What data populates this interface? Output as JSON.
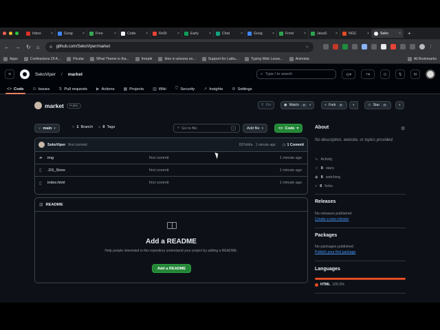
{
  "browser": {
    "tabs": [
      {
        "label": "Inbox",
        "color": "#d93025"
      },
      {
        "label": "Goog",
        "color": "#4285f4"
      },
      {
        "label": "Free",
        "color": "#34a853"
      },
      {
        "label": "Code",
        "color": "#f1f3f4"
      },
      {
        "label": "ReDi",
        "color": "#ea4335"
      },
      {
        "label": "Early",
        "color": "#0f9d58"
      },
      {
        "label": "Chat",
        "color": "#10a37f"
      },
      {
        "label": "Goog",
        "color": "#4285f4"
      },
      {
        "label": "Front",
        "color": "#2da44e"
      },
      {
        "label": "JavaS",
        "color": "#2da44e"
      },
      {
        "label": "NGC",
        "color": "#e34c26"
      },
      {
        "label": "Seko",
        "color": "#f0f6fc",
        "active": true
      }
    ],
    "url": "github.com/SekoViper/market",
    "bookmarks": [
      "Apps",
      "Confessions Of A...",
      "Picular",
      "What Theme is tha...",
      "freepik",
      "time in arizona no...",
      "Support for Latitu...",
      "Typing Web Lesso...",
      "Animista"
    ],
    "all_bookmarks": "All Bookmarks"
  },
  "header": {
    "owner": "SekoViper",
    "separator": "/",
    "repo": "market",
    "search_placeholder": "Type / to search",
    "search_key": "/"
  },
  "repo_nav": [
    {
      "icon": "<>",
      "label": "Code",
      "active": true
    },
    {
      "icon": "⊙",
      "label": "Issues"
    },
    {
      "icon": "⇅",
      "label": "Pull requests"
    },
    {
      "icon": "▶",
      "label": "Actions"
    },
    {
      "icon": "▦",
      "label": "Projects"
    },
    {
      "icon": "▥",
      "label": "Wiki"
    },
    {
      "icon": "⛉",
      "label": "Security"
    },
    {
      "icon": "↗",
      "label": "Insights"
    },
    {
      "icon": "⚙",
      "label": "Settings"
    }
  ],
  "repo": {
    "name": "market",
    "visibility": "Public",
    "pin": "Pin",
    "watch": "Watch",
    "watch_count": "0",
    "fork": "Fork",
    "fork_count": "0",
    "star": "Star",
    "star_count": "0"
  },
  "toolbar": {
    "branch": "main",
    "branch_count": "1",
    "branch_label": "Branch",
    "tag_count": "0",
    "tag_label": "Tags",
    "go_to_file": "Go to file",
    "go_to_file_key": "t",
    "add_file": "Add file",
    "code": "Code"
  },
  "latest_commit": {
    "user": "SekoViper",
    "message": "first commit",
    "hash_time": "837eb6a · 1 minute ago",
    "count_label": "1 Commit"
  },
  "files": [
    {
      "name": "img",
      "type": "folder",
      "message": "first commit",
      "time": "1 minute ago"
    },
    {
      "name": ".DS_Store",
      "type": "file",
      "message": "first commit",
      "time": "1 minute ago"
    },
    {
      "name": "index.html",
      "type": "file",
      "message": "first commit",
      "time": "1 minute ago"
    }
  ],
  "readme": {
    "header": "README",
    "title": "Add a README",
    "subtitle": "Help people interested in this repository understand your project by adding a README.",
    "button": "Add a README"
  },
  "about": {
    "title": "About",
    "description": "No description, website, or topics provided.",
    "items": [
      {
        "icon": "∿",
        "label": "Activity"
      },
      {
        "icon": "☆",
        "count": "0",
        "label": "stars"
      },
      {
        "icon": "◉",
        "count": "0",
        "label": "watching"
      },
      {
        "icon": "⑂",
        "count": "0",
        "label": "forks"
      }
    ]
  },
  "releases": {
    "title": "Releases",
    "text": "No releases published",
    "link": "Create a new release"
  },
  "packages": {
    "title": "Packages",
    "text": "No packages published",
    "link": "Publish your first package"
  },
  "languages": {
    "title": "Languages",
    "items": [
      {
        "name": "HTML",
        "percent": "100.0%",
        "color": "#e34c26"
      }
    ]
  },
  "colors": {
    "accent_green": "#238636",
    "link_blue": "#4493f8",
    "active_tab_underline": "#f78166"
  }
}
